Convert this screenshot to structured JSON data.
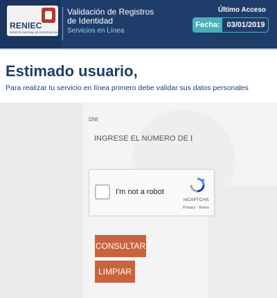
{
  "header": {
    "logo_text": "RENIEC",
    "logo_subtext": "REGISTRO NACIONAL DE IDENTIFICACIÓN Y ESTADO CIVIL",
    "app_title": "Validación de Registros de Identidad",
    "app_subtitle": "Servicios en Línea",
    "last_access_label": "Último Acceso",
    "date_label": "Fecha:",
    "date_value": "03/01/2019",
    "colors": {
      "primary": "#1f3d6b",
      "accent": "#4ab0b7"
    }
  },
  "main": {
    "greeting": "Estimado usuario,",
    "instructions": "Para realizar tu servicio en línea primero debe validar sus datos personales",
    "dni_label": "DNI",
    "dni_placeholder": "INGRESE EL NÚMERO DE DNI",
    "dni_value": ""
  },
  "captcha": {
    "label": "I'm not a robot",
    "brand": "reCAPTCHA",
    "links": "Privacy - Terms",
    "checked": false
  },
  "actions": {
    "consultar_label": "CONSULTAR",
    "limpiar_label": "LIMPIAR",
    "button_color": "#c8643c"
  }
}
